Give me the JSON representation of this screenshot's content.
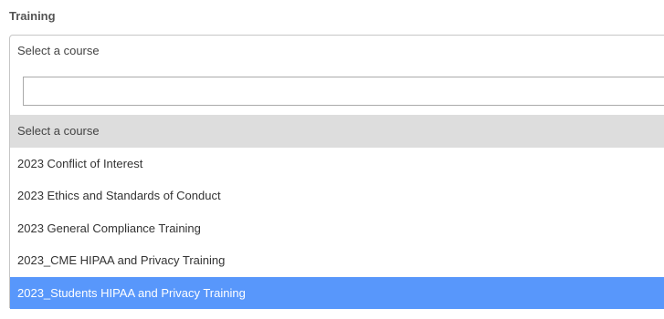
{
  "field": {
    "label": "Training"
  },
  "select": {
    "value": "Select a course"
  },
  "search": {
    "value": "",
    "placeholder": ""
  },
  "options": [
    {
      "label": "Select a course",
      "state": "selected"
    },
    {
      "label": "2023 Conflict of Interest",
      "state": "normal"
    },
    {
      "label": "2023 Ethics and Standards of Conduct",
      "state": "normal"
    },
    {
      "label": "2023 General Compliance Training",
      "state": "normal"
    },
    {
      "label": "2023_CME HIPAA and Privacy Training",
      "state": "normal"
    },
    {
      "label": "2023_Students HIPAA and Privacy Training",
      "state": "highlighted"
    }
  ],
  "colors": {
    "highlight": "#5897fb",
    "selected": "#dddddd"
  }
}
